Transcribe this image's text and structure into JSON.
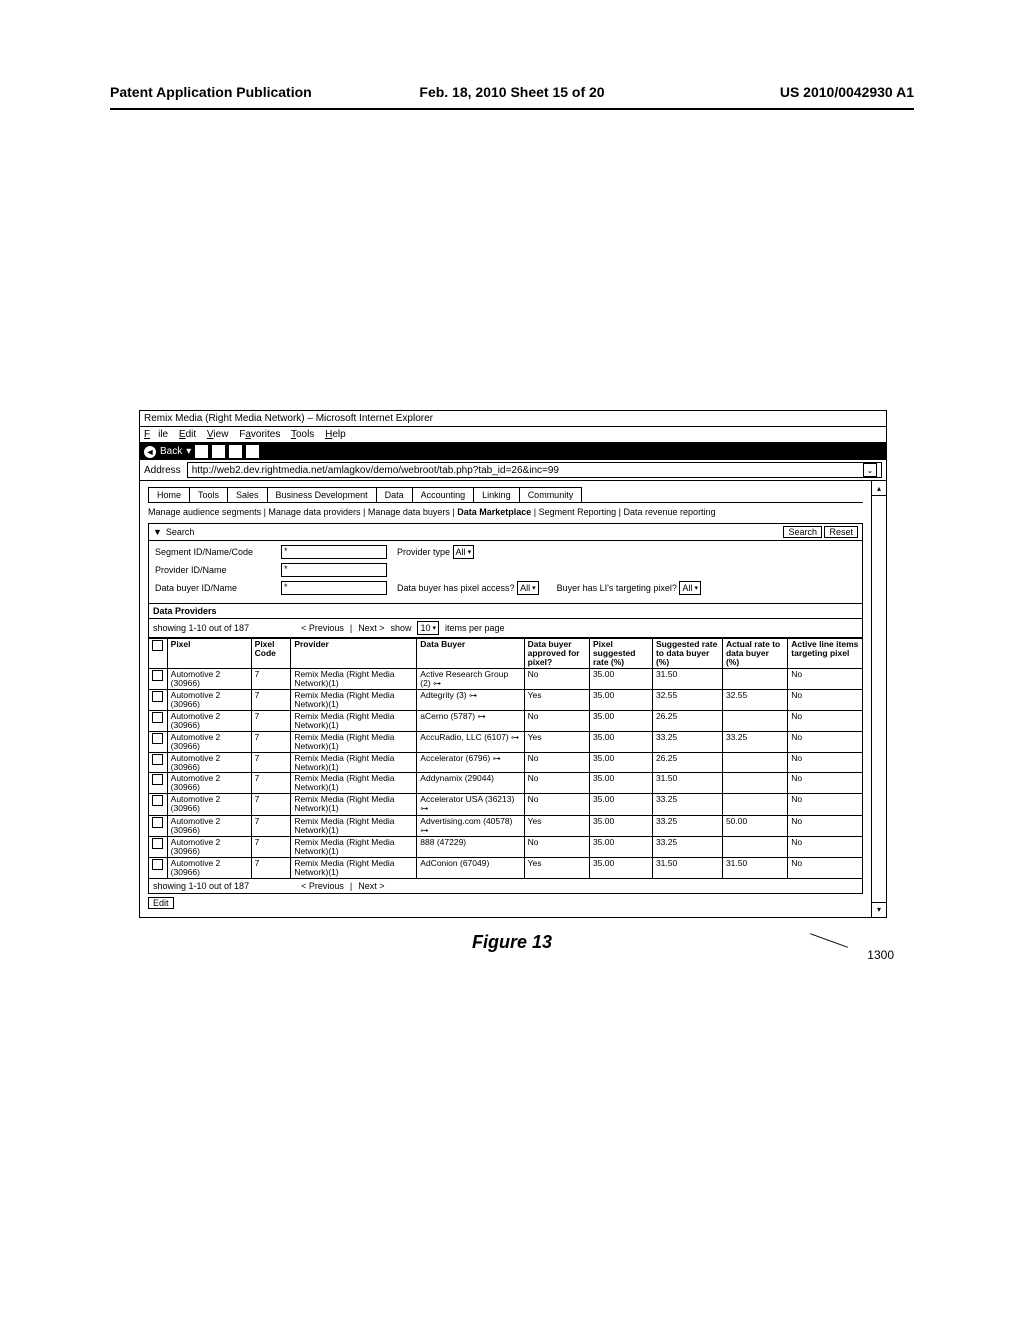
{
  "header": {
    "left": "Patent Application Publication",
    "date": "Feb. 18, 2010  Sheet 15 of 20",
    "right": "US 2010/0042930 A1"
  },
  "browser": {
    "title": "Remix Media (Right Media Network) – Microsoft Internet Explorer",
    "menu": {
      "file": "File",
      "edit": "Edit",
      "view": "View",
      "favorites": "Favorites",
      "tools": "Tools",
      "help": "Help"
    },
    "toolbar": {
      "back": "Back"
    },
    "address_label": "Address",
    "url": "http://web2.dev.rightmedia.net/amlagkov/demo/webroot/tab.php?tab_id=26&inc=99"
  },
  "tabs": [
    "Home",
    "Tools",
    "Sales",
    "Business Development",
    "Data",
    "Accounting",
    "Linking",
    "Community"
  ],
  "sublinks": {
    "items": [
      "Manage audience segments",
      "Manage data providers",
      "Manage data buyers",
      "Data Marketplace",
      "Segment Reporting",
      "Data revenue reporting"
    ],
    "active_index": 3
  },
  "search": {
    "panel_label": "Search",
    "search_btn": "Search",
    "reset_btn": "Reset",
    "fields": {
      "segment_label": "Segment ID/Name/Code",
      "provider_label": "Provider ID/Name",
      "buyer_label": "Data buyer ID/Name",
      "star": "*",
      "provider_type_label": "Provider type",
      "provider_type_value": "All",
      "pixel_access_label": "Data buyer has pixel access?",
      "pixel_access_value": "All",
      "targeting_label": "Buyer has LI's targeting pixel?",
      "targeting_value": "All"
    }
  },
  "dataproviders_title": "Data Providers",
  "pager": {
    "showing": "showing 1-10 out of 187",
    "prev": "< Previous",
    "next": "Next >",
    "show_label": "show",
    "per_page_value": "10",
    "per_page_suffix": "items per page"
  },
  "columns": [
    "",
    "Pixel",
    "Pixel Code",
    "Provider",
    "Data Buyer",
    "Data buyer approved for pixel?",
    "Pixel suggested rate (%)",
    "Suggested rate to data buyer (%)",
    "Actual rate to data buyer (%)",
    "Active line items targeting pixel"
  ],
  "rows": [
    {
      "pixel": "Automotive 2 (30966)",
      "code": "7",
      "provider": "Remix Media (Right Media Network)(1)",
      "buyer": "Active Research Group (2)",
      "buyer_link": true,
      "approved": "No",
      "sugg": "35.00",
      "sugg_buyer": "31.50",
      "actual": "",
      "active": "No"
    },
    {
      "pixel": "Automotive 2 (30966)",
      "code": "7",
      "provider": "Remix Media (Right Media Network)(1)",
      "buyer": "Adtegrity (3)",
      "buyer_link": true,
      "approved": "Yes",
      "sugg": "35.00",
      "sugg_buyer": "32.55",
      "actual": "32.55",
      "active": "No"
    },
    {
      "pixel": "Automotive 2 (30966)",
      "code": "7",
      "provider": "Remix Media (Right Media Network)(1)",
      "buyer": "aCerno (5787)",
      "buyer_link": true,
      "approved": "No",
      "sugg": "35.00",
      "sugg_buyer": "26.25",
      "actual": "",
      "active": "No"
    },
    {
      "pixel": "Automotive 2 (30966)",
      "code": "7",
      "provider": "Remix Media (Right Media Network)(1)",
      "buyer": "AccuRadio, LLC (6107)",
      "buyer_link": true,
      "approved": "Yes",
      "sugg": "35.00",
      "sugg_buyer": "33.25",
      "actual": "33.25",
      "active": "No"
    },
    {
      "pixel": "Automotive 2 (30966)",
      "code": "7",
      "provider": "Remix Media (Right Media Network)(1)",
      "buyer": "Accelerator (6796)",
      "buyer_link": true,
      "approved": "No",
      "sugg": "35.00",
      "sugg_buyer": "26.25",
      "actual": "",
      "active": "No"
    },
    {
      "pixel": "Automotive 2 (30966)",
      "code": "7",
      "provider": "Remix Media (Right Media Network)(1)",
      "buyer": "Addynamix (29044)",
      "buyer_link": false,
      "approved": "No",
      "sugg": "35.00",
      "sugg_buyer": "31.50",
      "actual": "",
      "active": "No"
    },
    {
      "pixel": "Automotive 2 (30966)",
      "code": "7",
      "provider": "Remix Media (Right Media Network)(1)",
      "buyer": "Accelerator USA (36213)",
      "buyer_link": true,
      "approved": "No",
      "sugg": "35.00",
      "sugg_buyer": "33.25",
      "actual": "",
      "active": "No"
    },
    {
      "pixel": "Automotive 2 (30966)",
      "code": "7",
      "provider": "Remix Media (Right Media Network)(1)",
      "buyer": "Advertising.com (40578)",
      "buyer_link": true,
      "approved": "Yes",
      "sugg": "35.00",
      "sugg_buyer": "33.25",
      "actual": "50.00",
      "active": "No"
    },
    {
      "pixel": "Automotive 2 (30966)",
      "code": "7",
      "provider": "Remix Media (Right Media Network)(1)",
      "buyer": "888 (47229)",
      "buyer_link": false,
      "approved": "No",
      "sugg": "35.00",
      "sugg_buyer": "33.25",
      "actual": "",
      "active": "No"
    },
    {
      "pixel": "Automotive 2 (30966)",
      "code": "7",
      "provider": "Remix Media (Right Media Network)(1)",
      "buyer": "AdConion (67049)",
      "buyer_link": false,
      "approved": "Yes",
      "sugg": "35.00",
      "sugg_buyer": "31.50",
      "actual": "31.50",
      "active": "No"
    }
  ],
  "edit_btn": "Edit",
  "figure": {
    "label": "Figure 13",
    "ref": "1300"
  }
}
